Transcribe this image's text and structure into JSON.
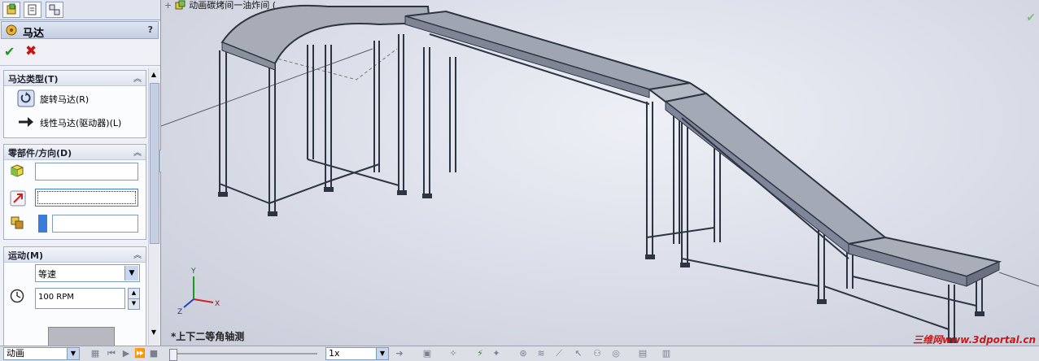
{
  "property_manager": {
    "title": "马达",
    "help": "?",
    "ok_icon": "check-icon",
    "cancel_icon": "x-icon",
    "groups": {
      "motor_type": {
        "title": "马达类型(T)",
        "options": [
          {
            "label": "旋转马达(R)",
            "icon": "rotary-motor-icon"
          },
          {
            "label": "线性马达(驱动器)(L)",
            "icon": "linear-motor-icon"
          }
        ]
      },
      "component_direction": {
        "title": "零部件/方向(D)",
        "fields": [
          {
            "icon": "component-icon",
            "value": ""
          },
          {
            "icon": "direction-icon",
            "value": ""
          },
          {
            "icon": "relative-to-icon",
            "value": ""
          }
        ]
      },
      "motion": {
        "title": "运动(M)",
        "type_value": "等速",
        "speed_value": "100 RPM"
      }
    }
  },
  "viewport": {
    "tree_root": "动画碳烤间一油炸间  (",
    "view_orientation": "*上下二等角轴测",
    "watermark": "三维网www.3dportal.cn",
    "triad": {
      "x": "X",
      "y": "Y",
      "z": "Z"
    }
  },
  "motion_bar": {
    "study_type": "动画",
    "playback_speed": "1x"
  },
  "colors": {
    "accent_blue": "#3b7bdc",
    "ok_green": "#1a9a1a",
    "cancel_red": "#cc1111",
    "watermark_red": "#c41a1a"
  }
}
